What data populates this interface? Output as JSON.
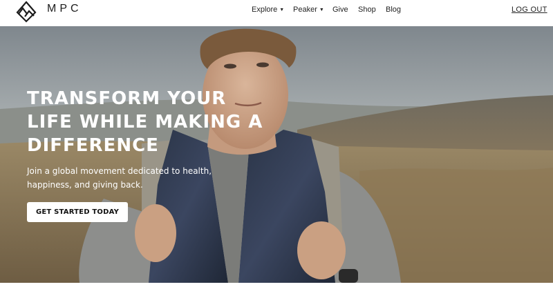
{
  "brand": {
    "name": "MPC",
    "logo_icon": "mountain-diamond-logo"
  },
  "nav": {
    "explore": "Explore",
    "peaker": "Peaker",
    "give": "Give",
    "shop": "Shop",
    "blog": "Blog",
    "dropdown_icon": "chevron-down-icon"
  },
  "account": {
    "logout": "LOG OUT"
  },
  "hero": {
    "title": "TRANSFORM YOUR LIFE WHILE MAKING A DIFFERENCE",
    "subtitle": "Join a global movement dedicated to health, happiness, and giving back.",
    "cta": "GET STARTED TODAY",
    "image": "man-with-backpack-on-moorland-photo"
  },
  "colors": {
    "text_dark": "#1c1c1c",
    "hero_text": "#ffffff",
    "button_bg": "#ffffff"
  }
}
